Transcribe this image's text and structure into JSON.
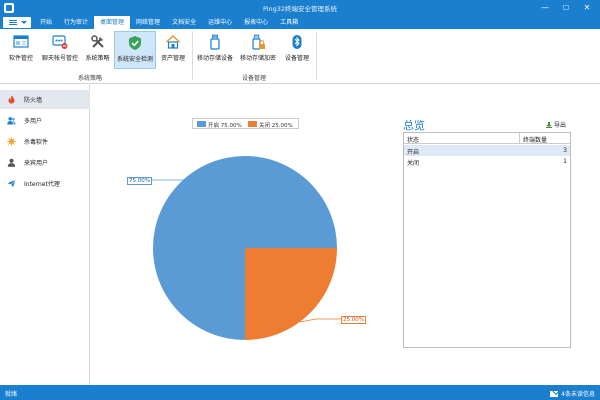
{
  "window": {
    "title": "Ping32终端安全管理系统",
    "controls": {
      "minimize": "—",
      "maximize": "☐",
      "close": "✕"
    }
  },
  "menu": {
    "tabs": [
      {
        "label": "开始",
        "active": false
      },
      {
        "label": "行为审计",
        "active": false
      },
      {
        "label": "桌面管理",
        "active": true
      },
      {
        "label": "网络管理",
        "active": false
      },
      {
        "label": "文档安全",
        "active": false
      },
      {
        "label": "运维中心",
        "active": false
      },
      {
        "label": "报表中心",
        "active": false
      },
      {
        "label": "工具箱",
        "active": false
      }
    ]
  },
  "ribbon": {
    "buttons": [
      {
        "label": "软件管控",
        "icon": "software-control-icon"
      },
      {
        "label": "聊天帐号管控",
        "icon": "chat-account-icon"
      },
      {
        "label": "系统策略",
        "icon": "tools-icon"
      },
      {
        "label": "系统安全检测",
        "icon": "shield-check-icon",
        "active": true
      },
      {
        "label": "资产管理",
        "icon": "asset-house-icon"
      },
      {
        "label": "移动存储设备",
        "icon": "usb-storage-icon"
      },
      {
        "label": "移动存储加密",
        "icon": "usb-lock-icon"
      },
      {
        "label": "设备管理",
        "icon": "bluetooth-icon"
      }
    ],
    "groups": [
      {
        "label": "系统策略"
      },
      {
        "label": "设备管理"
      }
    ]
  },
  "sidebar": {
    "items": [
      {
        "label": "防火墙",
        "icon": "firewall-flame-icon",
        "active": true
      },
      {
        "label": "多用户",
        "icon": "users-icon",
        "active": false
      },
      {
        "label": "杀毒软件",
        "icon": "antivirus-icon",
        "active": false
      },
      {
        "label": "来宾用户",
        "icon": "guest-user-icon",
        "active": false
      },
      {
        "label": "Internet代理",
        "icon": "proxy-plane-icon",
        "active": false
      }
    ]
  },
  "chart_data": {
    "type": "pie",
    "categories": [
      "开启",
      "关闭"
    ],
    "values": [
      75,
      25
    ],
    "legend_labels": [
      "开启  75.00%",
      "关闭  25.00%"
    ],
    "data_labels": [
      "75.00%",
      "25.00%"
    ],
    "colors": [
      "#5b9bd5",
      "#ed7d31"
    ],
    "legend_position": "top"
  },
  "overview": {
    "title": "总览",
    "export_label": "导出",
    "columns": [
      "状态",
      "终端数量"
    ],
    "rows": [
      {
        "status": "开启",
        "count": "3",
        "selected": true
      },
      {
        "status": "关闭",
        "count": "1",
        "selected": false
      }
    ]
  },
  "statusbar": {
    "status": "就绪",
    "messages": "4条未读信息"
  },
  "colors": {
    "accent": "#1b7fd0",
    "ribbon_active": "#cfe6f8",
    "sidebar_active": "#e3e7ee"
  }
}
